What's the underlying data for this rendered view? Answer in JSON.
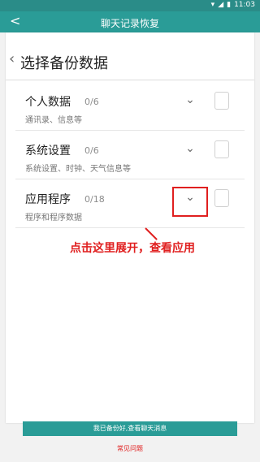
{
  "status": {
    "time": "11:03",
    "icons": [
      "wifi-icon",
      "signal-icon",
      "battery-icon"
    ]
  },
  "appbar": {
    "back_glyph": "<",
    "title": "聊天记录恢复"
  },
  "backup_header": {
    "back_glyph": "‹",
    "title": "选择备份数据"
  },
  "items": [
    {
      "name": "个人数据",
      "count": "0/6",
      "desc": "通讯录、信息等"
    },
    {
      "name": "系统设置",
      "count": "0/6",
      "desc": "系统设置、时钟、天气信息等"
    },
    {
      "name": "应用程序",
      "count": "0/18",
      "desc": "程序和程序数据"
    }
  ],
  "annotation": "点击这里展开，查看应用",
  "bottom": {
    "button_label": "我已备份好,查看聊天消息",
    "faq": "常见问题"
  },
  "colors": {
    "accent": "#2a9c97",
    "highlight": "#e01f1f"
  }
}
